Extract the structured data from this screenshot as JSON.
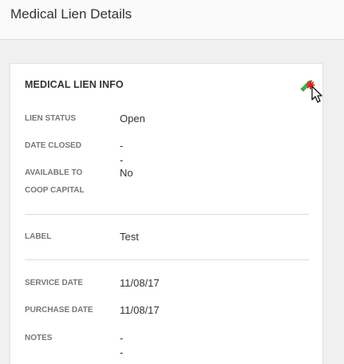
{
  "page": {
    "title": "Medical Lien Details"
  },
  "card": {
    "title": "MEDICAL LIEN INFO",
    "edit_icon": "pencil-edit-icon",
    "fields": {
      "lien_status": {
        "label": "LIEN STATUS",
        "value": "Open"
      },
      "date_closed": {
        "label": "DATE CLOSED",
        "value": "--"
      },
      "available_coop": {
        "label_line1": "AVAILABLE TO",
        "label_line2": "COOP CAPITAL",
        "value": "No"
      },
      "label": {
        "label": "LABEL",
        "value": "Test"
      },
      "service_date": {
        "label": "SERVICE DATE",
        "value": "11/08/17"
      },
      "purchase_date": {
        "label": "PURCHASE DATE",
        "value": "11/08/17"
      },
      "notes": {
        "label": "NOTES",
        "value": "--"
      }
    }
  },
  "colors": {
    "edit_icon_green": "#3bb54a",
    "edit_icon_red": "#e02424"
  }
}
